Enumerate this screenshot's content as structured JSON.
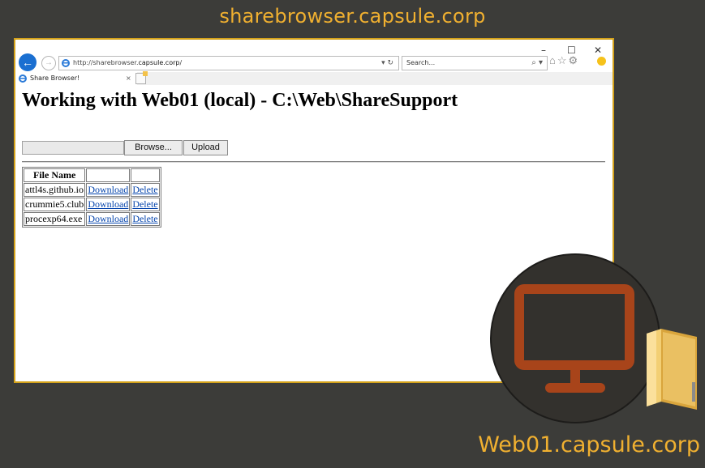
{
  "captions": {
    "top": "sharebrowser.capsule.corp",
    "bottom": "Web01.capsule.corp"
  },
  "browser": {
    "window_controls": [
      "–",
      "☐",
      "✕"
    ],
    "address_host": "http://sharebrowser.",
    "address_domain": "capsule.corp",
    "address_path": "/",
    "address_controls": "▾ ↻",
    "search_placeholder": "Search...",
    "search_controls": "⌕ ▾",
    "tool_icons": "⌂☆⚙",
    "tab_title": "Share Browser!",
    "tab_close": "×"
  },
  "page": {
    "heading": "Working with Web01 (local) - C:\\Web\\ShareSupport",
    "browse_label": "Browse...",
    "upload_label": "Upload",
    "table": {
      "headers": [
        "File Name",
        "",
        ""
      ],
      "rows": [
        {
          "name": "attl4s.github.io",
          "download": "Download",
          "delete": "Delete"
        },
        {
          "name": "crummie5.club",
          "download": "Download",
          "delete": "Delete"
        },
        {
          "name": "procexp64.exe",
          "download": "Download",
          "delete": "Delete"
        }
      ]
    }
  },
  "colors": {
    "background": "#3c3c39",
    "caption": "#f0b030",
    "window_border": "#d4a21a",
    "monitor": "#a8441a",
    "link": "#0645ad"
  },
  "icons": [
    "back-arrow-icon",
    "forward-arrow-icon",
    "ie-logo-icon",
    "refresh-icon",
    "search-icon",
    "home-icon",
    "favorites-star-icon",
    "settings-gear-icon",
    "feedback-smiley-icon",
    "monitor-icon",
    "folder-icon"
  ]
}
